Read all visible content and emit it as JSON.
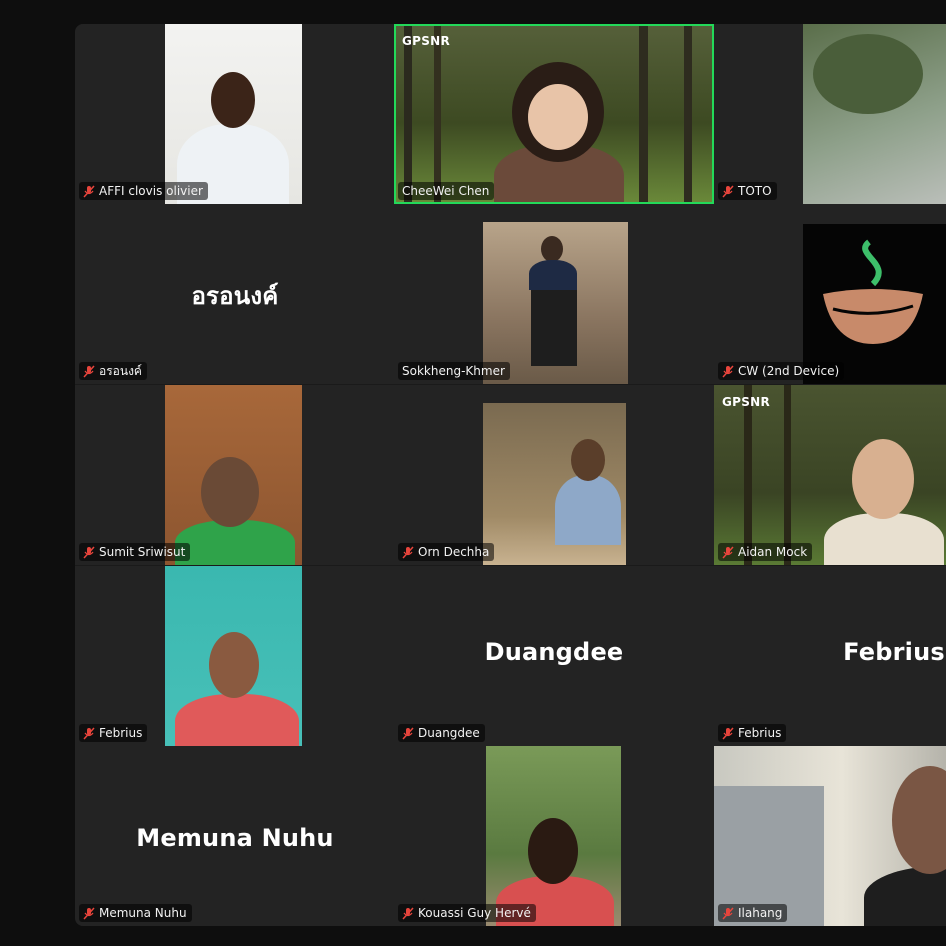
{
  "participants": [
    {
      "name": "AFFI clovis olivier",
      "muted": true
    },
    {
      "name": "CheeWei Chen",
      "muted": false,
      "logo": "GPSNR"
    },
    {
      "name": "TOTO",
      "muted": true
    },
    {
      "name": "อรอนงค์",
      "muted": true,
      "display_name": "อรอนงค์"
    },
    {
      "name": "Sokkheng-Khmer",
      "muted": false
    },
    {
      "name": "CW (2nd Device)",
      "muted": true
    },
    {
      "name": "Sumit Sriwisut",
      "muted": true
    },
    {
      "name": "Orn Dechha",
      "muted": true
    },
    {
      "name": "Aidan Mock",
      "muted": true,
      "logo": "GPSNR"
    },
    {
      "name": "Febrius",
      "muted": true
    },
    {
      "name": "Duangdee",
      "muted": true,
      "display_name": "Duangdee"
    },
    {
      "name": "Febrius",
      "muted": true,
      "display_name": "Febrius"
    },
    {
      "name": "Memuna Nuhu",
      "muted": true,
      "display_name": "Memuna Nuhu"
    },
    {
      "name": "Kouassi Guy Hervé",
      "muted": true
    },
    {
      "name": "Ilahang",
      "muted": true
    }
  ],
  "colors": {
    "active_speaker_border": "#23d959",
    "mute_icon": "#e8453c",
    "tile_background": "#232323"
  },
  "icons": {
    "mute": "microphone-muted-icon"
  }
}
